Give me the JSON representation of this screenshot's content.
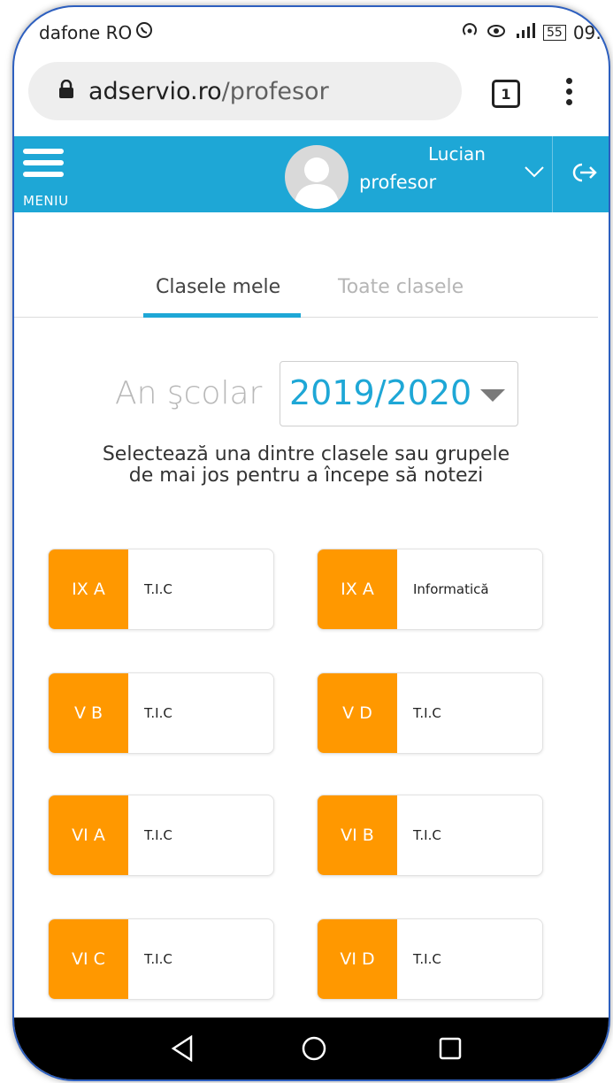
{
  "status_bar": {
    "carrier": "dafone RO",
    "battery": "55",
    "time": "09:"
  },
  "browser": {
    "url_host": "adservio.ro",
    "url_path": "/profesor",
    "tab_count": "1"
  },
  "header": {
    "menu_label": "MENIU",
    "user_name": "Lucian",
    "user_role": "profesor"
  },
  "tabs": [
    {
      "label": "Clasele mele",
      "active": true
    },
    {
      "label": "Toate clasele",
      "active": false
    }
  ],
  "year_selector": {
    "label": "An şcolar",
    "value": "2019/2020"
  },
  "instruction": "Selectează una dintre clasele sau grupele de mai jos pentru a începe să notezi",
  "classes": [
    {
      "class": "IX A",
      "subject": "T.I.C"
    },
    {
      "class": "IX A",
      "subject": "Informatică"
    },
    {
      "class": "V B",
      "subject": "T.I.C"
    },
    {
      "class": "V D",
      "subject": "T.I.C"
    },
    {
      "class": "VI A",
      "subject": "T.I.C"
    },
    {
      "class": "VI B",
      "subject": "T.I.C"
    },
    {
      "class": "VI C",
      "subject": "T.I.C"
    },
    {
      "class": "VI D",
      "subject": "T.I.C"
    }
  ],
  "colors": {
    "accent": "#1ea7d6",
    "class_badge": "#ff9800"
  },
  "icons": {
    "lock": "lock-icon",
    "menu": "hamburger-icon",
    "avatar": "user-avatar-icon",
    "dropdown": "chevron-down-icon",
    "logout": "logout-icon",
    "back": "back-triangle-icon",
    "home": "home-circle-icon",
    "recent": "recent-apps-square-icon"
  }
}
